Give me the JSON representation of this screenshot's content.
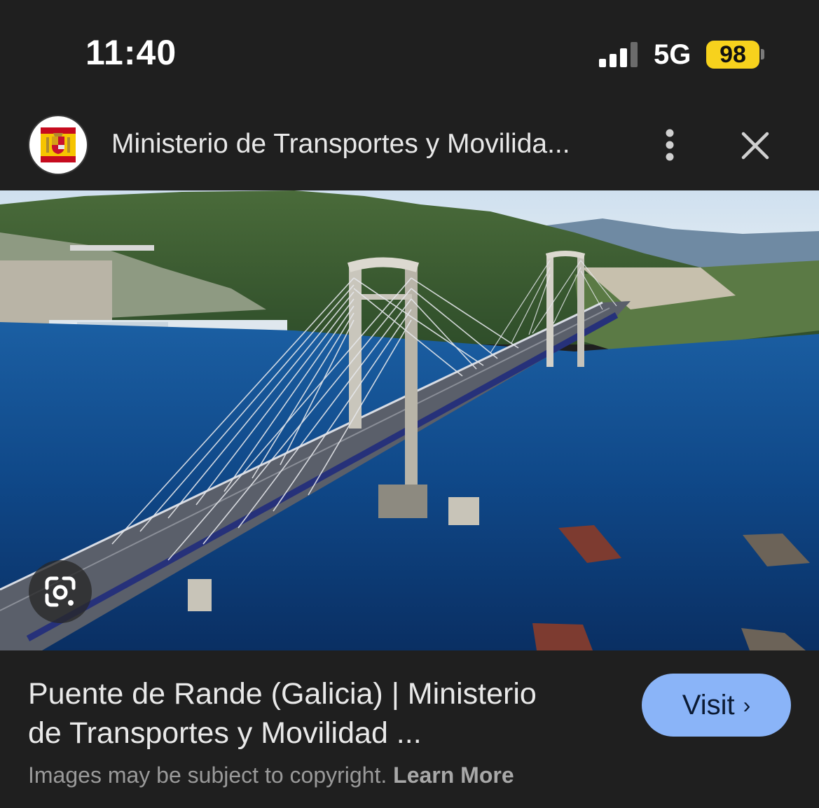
{
  "status_bar": {
    "time": "11:40",
    "network": "5G",
    "battery": "98"
  },
  "header": {
    "site_name": "Ministerio de Transportes y Movilida...",
    "logo_icon": "spain-coat-of-arms-icon",
    "more_icon": "more-vert-icon",
    "close_icon": "close-icon"
  },
  "image": {
    "lens_icon": "google-lens-icon"
  },
  "result": {
    "title_line1": "Puente de Rande (Galicia) | Ministerio",
    "title_line2": "de Transportes y Movilidad ...",
    "visit_label": "Visit",
    "copyright_text": "Images may be subject to copyright.",
    "learn_more_label": "Learn More"
  },
  "colors": {
    "background": "#1f1f1f",
    "visit_button": "#8ab4f8",
    "battery": "#f7d21d"
  }
}
